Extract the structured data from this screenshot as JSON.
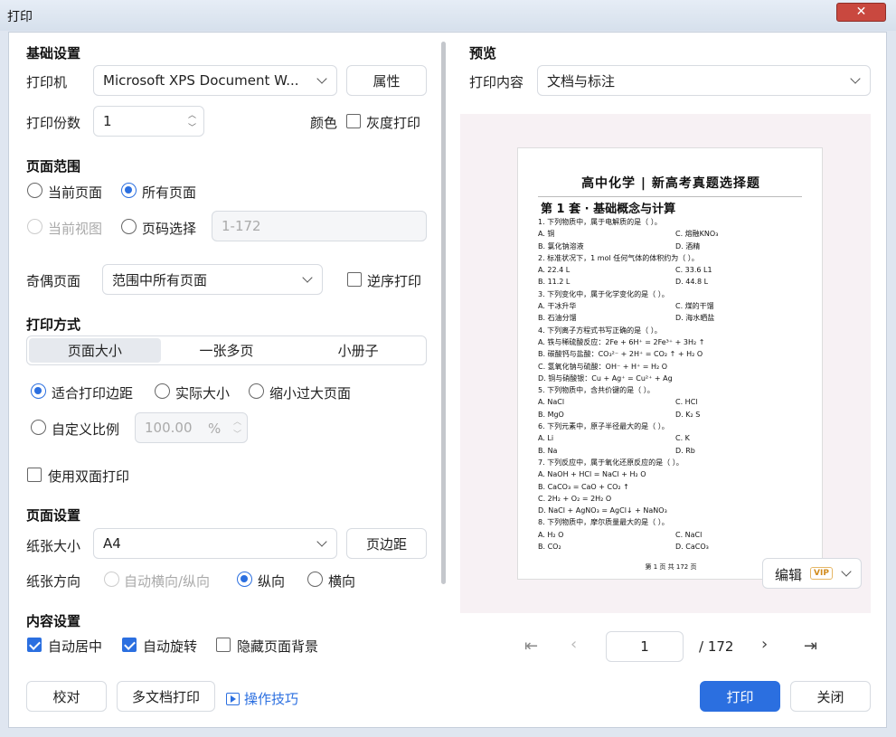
{
  "window": {
    "title": "打印",
    "close_label": "✕"
  },
  "left": {
    "basic_title": "基础设置",
    "printer_label": "打印机",
    "printer_value": "Microsoft XPS Document W...",
    "properties_button": "属性",
    "copies_label": "打印份数",
    "copies_value": "1",
    "color_label": "颜色",
    "grayscale_label": "灰度打印",
    "range_title": "页面范围",
    "range_current": "当前页面",
    "range_all": "所有页面",
    "range_view": "当前视图",
    "range_pages": "页码选择",
    "range_pages_placeholder": "1-172",
    "oddeven_label": "奇偶页面",
    "oddeven_value": "范围中所有页面",
    "reverse_label": "逆序打印",
    "mode_title": "打印方式",
    "mode_tabs": [
      "页面大小",
      "一张多页",
      "小册子"
    ],
    "fit_margins": "适合打印边距",
    "actual_size": "实际大小",
    "shrink_large": "缩小过大页面",
    "custom_scale": "自定义比例",
    "scale_value": "100.00",
    "scale_unit": "%",
    "duplex_label": "使用双面打印",
    "page_title": "页面设置",
    "paper_label": "纸张大小",
    "paper_value": "A4",
    "margins_button": "页边距",
    "orientation_label": "纸张方向",
    "orient_auto": "自动横向/纵向",
    "orient_portrait": "纵向",
    "orient_landscape": "横向",
    "content_title": "内容设置",
    "auto_center": "自动居中",
    "auto_rotate": "自动旋转",
    "hide_bg": "隐藏页面背景"
  },
  "right": {
    "preview_title": "预览",
    "content_label": "打印内容",
    "content_value": "文档与标注",
    "edit_label": "编辑",
    "vip_label": "VIP",
    "page_input": "1",
    "page_total": "/ 172"
  },
  "document": {
    "title": "高中化学 | 新高考真题选择题",
    "subtitle": "第 1 套 · 基础概念与计算",
    "lines": [
      [
        "1. 下列物质中，属于电解质的是（ ）。",
        ""
      ],
      [
        "A. 铜",
        "C. 熔融KNO₃"
      ],
      [
        "B. 氯化钠溶液",
        "D. 酒精"
      ],
      [
        "2. 标准状况下，1 mol 任何气体的体积约为（ ）。",
        ""
      ],
      [
        "A. 22.4 L",
        "C. 33.6 L1"
      ],
      [
        "B. 11.2 L",
        "D. 44.8 L"
      ],
      [
        "3. 下列变化中，属于化学变化的是（ ）。",
        ""
      ],
      [
        "A. 干冰升华",
        "C. 煤的干馏"
      ],
      [
        "B. 石油分馏",
        "D. 海水晒盐"
      ],
      [
        "4. 下列离子方程式书写正确的是（ ）。",
        ""
      ],
      [
        "A. 铁与稀硫酸反应：2Fe + 6H⁺ = 2Fe³⁺ + 3H₂ ↑",
        ""
      ],
      [
        "B. 碳酸钙与盐酸：CO₃²⁻ + 2H⁺ = CO₂ ↑ + H₂ O",
        ""
      ],
      [
        "C. 氢氧化钠与硫酸：OH⁻ + H⁺ = H₂ O",
        ""
      ],
      [
        "D. 铜与硝酸银：Cu + Ag⁺ = Cu²⁺ + Ag",
        ""
      ],
      [
        "5. 下列物质中，含共价键的是（ ）。",
        ""
      ],
      [
        "A. NaCl",
        "C. HCl"
      ],
      [
        "B. MgO",
        "D. K₂ S"
      ],
      [
        "6. 下列元素中，原子半径最大的是（ ）。",
        ""
      ],
      [
        "A. Li",
        "C. K"
      ],
      [
        "B. Na",
        "D. Rb"
      ],
      [
        "7. 下列反应中，属于氧化还原反应的是（ ）。",
        ""
      ],
      [
        "A. NaOH + HCl = NaCl + H₂ O",
        ""
      ],
      [
        "B. CaCO₃ = CaO + CO₂ ↑",
        ""
      ],
      [
        "C. 2H₂ + O₂ = 2H₂ O",
        ""
      ],
      [
        "D. NaCl + AgNO₃ = AgCl↓ + NaNO₃",
        ""
      ],
      [
        "8. 下列物质中，摩尔质量最大的是（ ）。",
        ""
      ],
      [
        "A. H₂ O",
        "C. NaCl"
      ],
      [
        "B. CO₂",
        "D. CaCO₃"
      ]
    ],
    "footer": "第 1 页 共 172 页"
  },
  "footer": {
    "proof_button": "校对",
    "multi_button": "多文档打印",
    "tips_link": "操作技巧",
    "print_button": "打印",
    "close_button": "关闭"
  },
  "colors": {
    "accent": "#2b6fe0",
    "titlebar": "#dfe6f0",
    "close": "#c9483f"
  }
}
